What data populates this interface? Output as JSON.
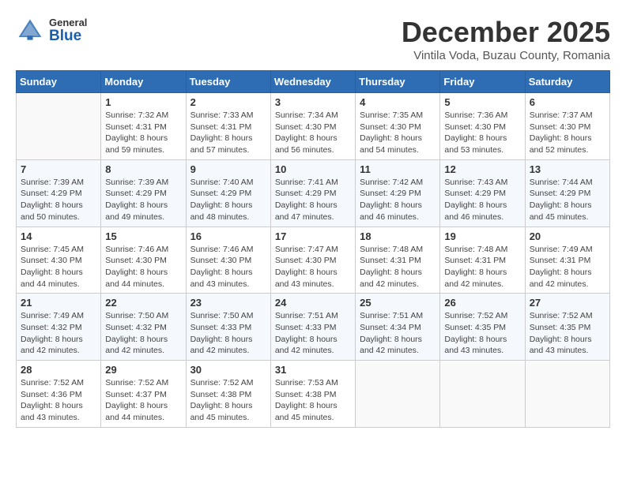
{
  "header": {
    "logo_general": "General",
    "logo_blue": "Blue",
    "month_title": "December 2025",
    "location": "Vintila Voda, Buzau County, Romania"
  },
  "days_of_week": [
    "Sunday",
    "Monday",
    "Tuesday",
    "Wednesday",
    "Thursday",
    "Friday",
    "Saturday"
  ],
  "weeks": [
    [
      {
        "day": "",
        "info": ""
      },
      {
        "day": "1",
        "info": "Sunrise: 7:32 AM\nSunset: 4:31 PM\nDaylight: 8 hours\nand 59 minutes."
      },
      {
        "day": "2",
        "info": "Sunrise: 7:33 AM\nSunset: 4:31 PM\nDaylight: 8 hours\nand 57 minutes."
      },
      {
        "day": "3",
        "info": "Sunrise: 7:34 AM\nSunset: 4:30 PM\nDaylight: 8 hours\nand 56 minutes."
      },
      {
        "day": "4",
        "info": "Sunrise: 7:35 AM\nSunset: 4:30 PM\nDaylight: 8 hours\nand 54 minutes."
      },
      {
        "day": "5",
        "info": "Sunrise: 7:36 AM\nSunset: 4:30 PM\nDaylight: 8 hours\nand 53 minutes."
      },
      {
        "day": "6",
        "info": "Sunrise: 7:37 AM\nSunset: 4:30 PM\nDaylight: 8 hours\nand 52 minutes."
      }
    ],
    [
      {
        "day": "7",
        "info": "Sunrise: 7:39 AM\nSunset: 4:29 PM\nDaylight: 8 hours\nand 50 minutes."
      },
      {
        "day": "8",
        "info": "Sunrise: 7:39 AM\nSunset: 4:29 PM\nDaylight: 8 hours\nand 49 minutes."
      },
      {
        "day": "9",
        "info": "Sunrise: 7:40 AM\nSunset: 4:29 PM\nDaylight: 8 hours\nand 48 minutes."
      },
      {
        "day": "10",
        "info": "Sunrise: 7:41 AM\nSunset: 4:29 PM\nDaylight: 8 hours\nand 47 minutes."
      },
      {
        "day": "11",
        "info": "Sunrise: 7:42 AM\nSunset: 4:29 PM\nDaylight: 8 hours\nand 46 minutes."
      },
      {
        "day": "12",
        "info": "Sunrise: 7:43 AM\nSunset: 4:29 PM\nDaylight: 8 hours\nand 46 minutes."
      },
      {
        "day": "13",
        "info": "Sunrise: 7:44 AM\nSunset: 4:29 PM\nDaylight: 8 hours\nand 45 minutes."
      }
    ],
    [
      {
        "day": "14",
        "info": "Sunrise: 7:45 AM\nSunset: 4:30 PM\nDaylight: 8 hours\nand 44 minutes."
      },
      {
        "day": "15",
        "info": "Sunrise: 7:46 AM\nSunset: 4:30 PM\nDaylight: 8 hours\nand 44 minutes."
      },
      {
        "day": "16",
        "info": "Sunrise: 7:46 AM\nSunset: 4:30 PM\nDaylight: 8 hours\nand 43 minutes."
      },
      {
        "day": "17",
        "info": "Sunrise: 7:47 AM\nSunset: 4:30 PM\nDaylight: 8 hours\nand 43 minutes."
      },
      {
        "day": "18",
        "info": "Sunrise: 7:48 AM\nSunset: 4:31 PM\nDaylight: 8 hours\nand 42 minutes."
      },
      {
        "day": "19",
        "info": "Sunrise: 7:48 AM\nSunset: 4:31 PM\nDaylight: 8 hours\nand 42 minutes."
      },
      {
        "day": "20",
        "info": "Sunrise: 7:49 AM\nSunset: 4:31 PM\nDaylight: 8 hours\nand 42 minutes."
      }
    ],
    [
      {
        "day": "21",
        "info": "Sunrise: 7:49 AM\nSunset: 4:32 PM\nDaylight: 8 hours\nand 42 minutes."
      },
      {
        "day": "22",
        "info": "Sunrise: 7:50 AM\nSunset: 4:32 PM\nDaylight: 8 hours\nand 42 minutes."
      },
      {
        "day": "23",
        "info": "Sunrise: 7:50 AM\nSunset: 4:33 PM\nDaylight: 8 hours\nand 42 minutes."
      },
      {
        "day": "24",
        "info": "Sunrise: 7:51 AM\nSunset: 4:33 PM\nDaylight: 8 hours\nand 42 minutes."
      },
      {
        "day": "25",
        "info": "Sunrise: 7:51 AM\nSunset: 4:34 PM\nDaylight: 8 hours\nand 42 minutes."
      },
      {
        "day": "26",
        "info": "Sunrise: 7:52 AM\nSunset: 4:35 PM\nDaylight: 8 hours\nand 43 minutes."
      },
      {
        "day": "27",
        "info": "Sunrise: 7:52 AM\nSunset: 4:35 PM\nDaylight: 8 hours\nand 43 minutes."
      }
    ],
    [
      {
        "day": "28",
        "info": "Sunrise: 7:52 AM\nSunset: 4:36 PM\nDaylight: 8 hours\nand 43 minutes."
      },
      {
        "day": "29",
        "info": "Sunrise: 7:52 AM\nSunset: 4:37 PM\nDaylight: 8 hours\nand 44 minutes."
      },
      {
        "day": "30",
        "info": "Sunrise: 7:52 AM\nSunset: 4:38 PM\nDaylight: 8 hours\nand 45 minutes."
      },
      {
        "day": "31",
        "info": "Sunrise: 7:53 AM\nSunset: 4:38 PM\nDaylight: 8 hours\nand 45 minutes."
      },
      {
        "day": "",
        "info": ""
      },
      {
        "day": "",
        "info": ""
      },
      {
        "day": "",
        "info": ""
      }
    ]
  ]
}
